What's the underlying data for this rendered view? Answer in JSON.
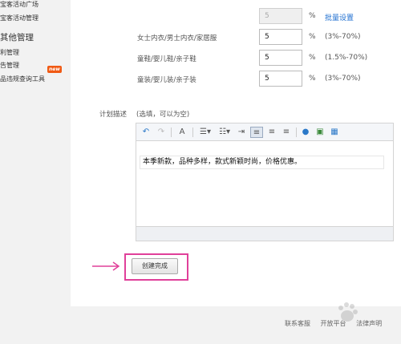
{
  "sidebar": {
    "links_top": [
      "宝客活动广场",
      "宝客活动管理"
    ],
    "section_title": "其他管理",
    "links": [
      "利管理",
      "告管理",
      "品违规查询工具"
    ],
    "new_badge": "new"
  },
  "commission": {
    "default_value": "5",
    "default_unit": "%",
    "batch_link": "批量设置",
    "rows": [
      {
        "label": "女士内衣/男士内衣/家居服",
        "value": "5",
        "unit": "%",
        "range": "(3%-70%)"
      },
      {
        "label": "童鞋/婴儿鞋/亲子鞋",
        "value": "5",
        "unit": "%",
        "range": "(1.5%-70%)"
      },
      {
        "label": "童装/婴儿装/亲子装",
        "value": "5",
        "unit": "%",
        "range": "(3%-70%)"
      }
    ]
  },
  "description": {
    "label": "计划描述",
    "hint": "(选填，可以为空)",
    "content": "本季新款，品种多样，款式新颖时尚，价格优惠。"
  },
  "toolbar": {
    "icons": [
      "undo-icon",
      "redo-icon",
      "format-brush-icon",
      "unordered-list-icon",
      "ordered-list-icon",
      "indent-icon",
      "align-left-icon",
      "align-center-icon",
      "align-right-icon",
      "link-icon",
      "image-icon",
      "table-icon"
    ]
  },
  "submit": {
    "label": "创建完成"
  },
  "annotation": {
    "arrow_color": "#e0409a",
    "highlight_color": "#e0409a"
  },
  "footer": {
    "links": [
      "联系客服",
      "开放平台",
      "法律声明"
    ]
  },
  "colors": {
    "link": "#1f6fd0",
    "badge": "#f05a14"
  }
}
